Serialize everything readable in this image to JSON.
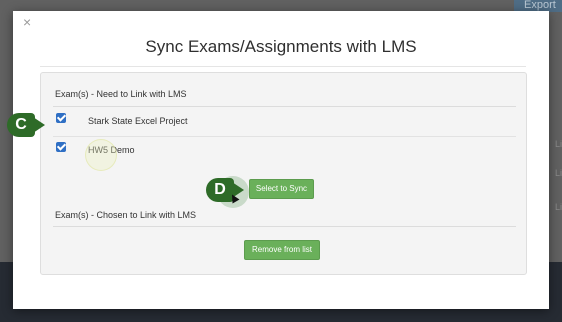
{
  "backdrop": {
    "tab_label": "Export",
    "side_letters": [
      "Li",
      "Li",
      "Li"
    ]
  },
  "modal": {
    "close_label": "×",
    "title": "Sync Exams/Assignments with LMS",
    "need_section_label": "Exam(s) - Need to Link with LMS",
    "items": [
      {
        "label": "Stark State Excel Project",
        "checked": true
      },
      {
        "label": "HW5 Demo",
        "checked": true
      }
    ],
    "sync_button": "Select to Sync",
    "chosen_section_label": "Exam(s) - Chosen to Link with LMS",
    "remove_button": "Remove from list"
  },
  "markers": {
    "c": "C",
    "d": "D"
  },
  "colors": {
    "accent_green": "#6ab05a",
    "marker_green": "#2e6b28",
    "checkbox_blue": "#2f6fc4"
  }
}
